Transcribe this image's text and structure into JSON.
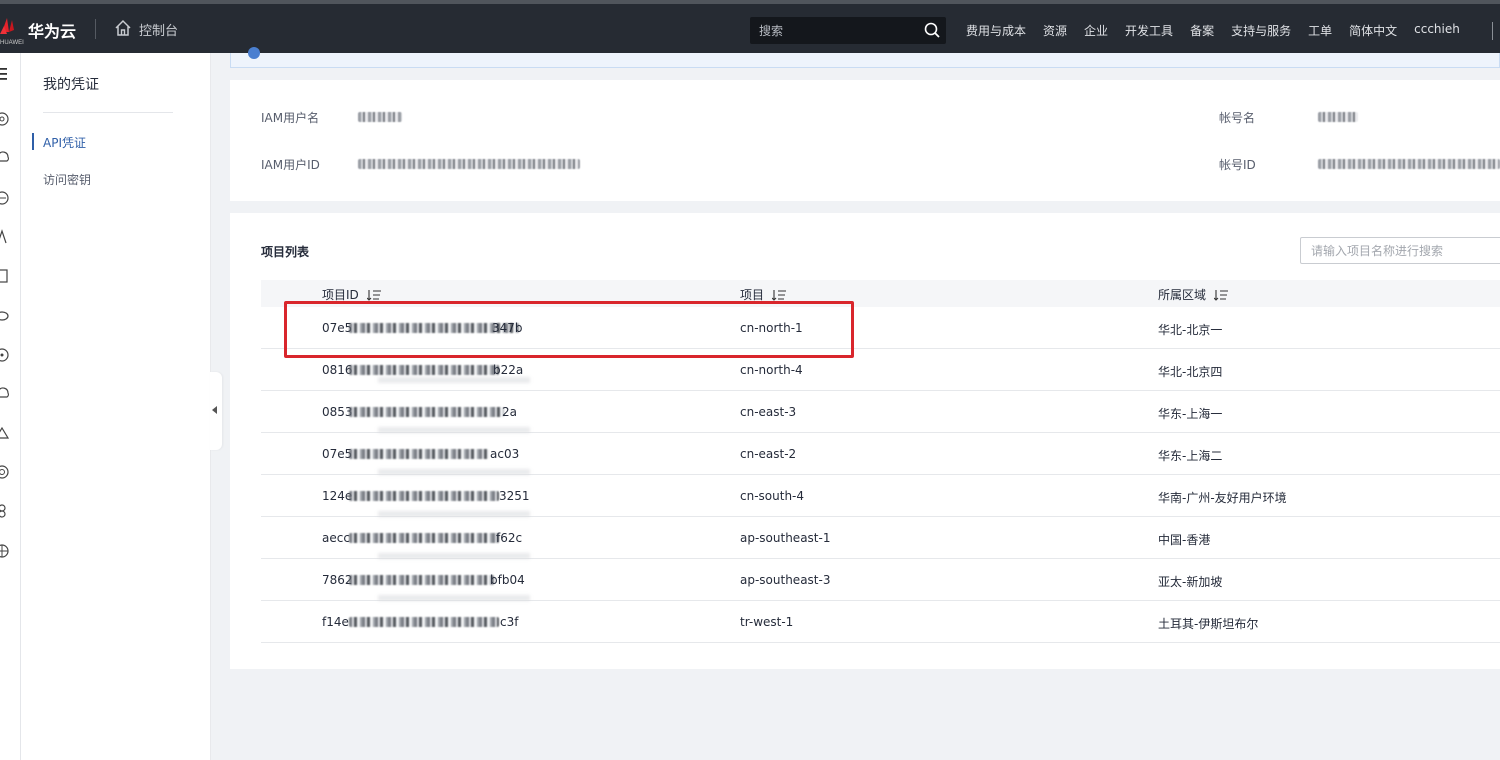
{
  "topbar": {
    "logo_text": "HUAWEI",
    "brand": "华为云",
    "console": "控制台",
    "search_placeholder": "搜索",
    "nav": [
      "费用与成本",
      "资源",
      "企业",
      "开发工具",
      "备案",
      "支持与服务",
      "工单",
      "简体中文"
    ],
    "user": "ccchieh"
  },
  "sidebar": {
    "title": "我的凭证",
    "items": [
      {
        "label": "API凭证",
        "active": true
      },
      {
        "label": "访问密钥",
        "active": false
      }
    ]
  },
  "account": {
    "iam_user_name_label": "IAM用户名",
    "iam_user_id_label": "IAM用户ID",
    "account_name_label": "帐号名",
    "account_id_label": "帐号ID"
  },
  "projects": {
    "title": "项目列表",
    "search_placeholder": "请输入项目名称进行搜索",
    "columns": [
      "项目ID",
      "项目",
      "所属区域"
    ],
    "rows": [
      {
        "id_prefix": "07e5",
        "id_suffix": "347b",
        "project": "cn-north-1",
        "region": "华北-北京一",
        "highlighted": true
      },
      {
        "id_prefix": "0816",
        "id_suffix": "b22a",
        "project": "cn-north-4",
        "region": "华北-北京四",
        "highlighted": false
      },
      {
        "id_prefix": "0853",
        "id_suffix": "2a",
        "project": "cn-east-3",
        "region": "华东-上海一",
        "highlighted": false
      },
      {
        "id_prefix": "07e5",
        "id_suffix": "ac03",
        "project": "cn-east-2",
        "region": "华东-上海二",
        "highlighted": false
      },
      {
        "id_prefix": "124e",
        "id_suffix": "3251",
        "project": "cn-south-4",
        "region": "华南-广州-友好用户环境",
        "highlighted": false
      },
      {
        "id_prefix": "aecc",
        "id_suffix": "f62c",
        "project": "ap-southeast-1",
        "region": "中国-香港",
        "highlighted": false
      },
      {
        "id_prefix": "7862",
        "id_suffix": "bfb04",
        "project": "ap-southeast-3",
        "region": "亚太-新加坡",
        "highlighted": false
      },
      {
        "id_prefix": "f14e",
        "id_suffix": "c3f",
        "project": "tr-west-1",
        "region": "土耳其-伊斯坦布尔",
        "highlighted": false
      }
    ]
  },
  "colors": {
    "topbar_bg": "#262b33",
    "accent_blue": "#2f5fa8",
    "highlight_red": "#d9262c"
  }
}
